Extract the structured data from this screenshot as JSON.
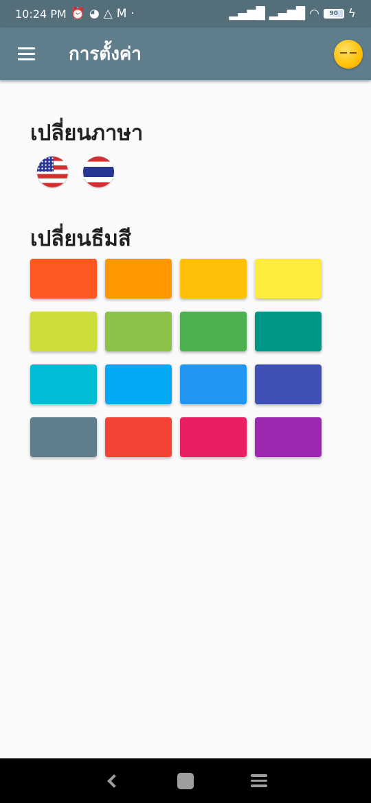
{
  "status_bar": {
    "time": "10:24 PM",
    "battery": "90",
    "icons": [
      "alarm-icon",
      "pie-icon",
      "triangle-icon",
      "gmail-icon",
      "dot-icon",
      "signal-icon",
      "signal-icon",
      "wifi-icon",
      "battery-icon",
      "charging-icon"
    ]
  },
  "app_bar": {
    "title": "การตั้งค่า",
    "menu_icon": "hamburger-icon",
    "avatar_icon": "emoji-face-icon"
  },
  "language_section": {
    "title": "เปลี่ยนภาษา",
    "flags": [
      {
        "name": "us-flag-icon"
      },
      {
        "name": "thai-flag-icon"
      }
    ]
  },
  "theme_section": {
    "title": "เปลี่ยนธีมสี",
    "colors": [
      "#ff5722",
      "#ff9800",
      "#ffc107",
      "#ffeb3b",
      "#cddc39",
      "#8bc34a",
      "#4caf50",
      "#009688",
      "#00bcd4",
      "#03a9f4",
      "#2196f3",
      "#3f51b5",
      "#607d8b",
      "#f44336",
      "#e91e63",
      "#9c27b0"
    ]
  },
  "nav_bar": {
    "icons": [
      "back-icon",
      "home-icon",
      "recents-icon"
    ]
  }
}
